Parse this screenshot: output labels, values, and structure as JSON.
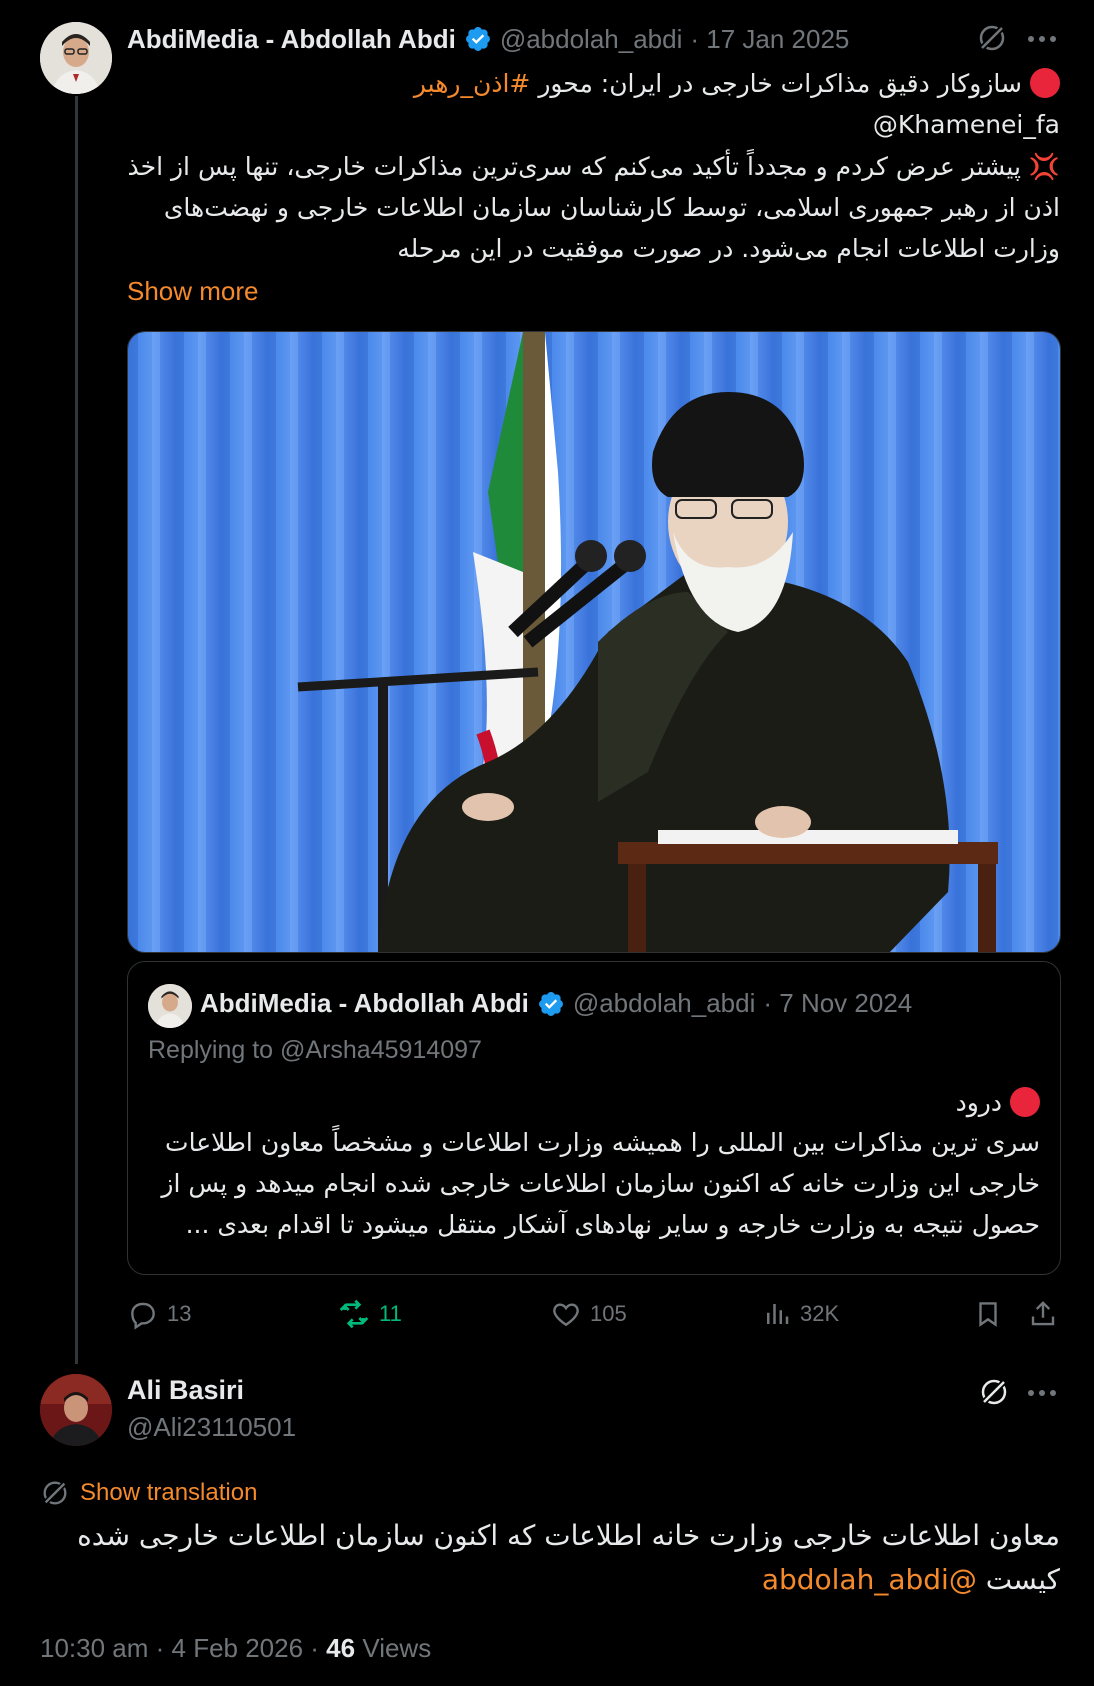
{
  "main_tweet": {
    "display_name": "AbdiMedia - Abdollah Abdi",
    "handle": "@abdolah_abdi",
    "date": "· 17 Jan 2025",
    "line1_text": "سازوکار دقیق مذاکرات خارجی در ایران: محور",
    "line1_hashtag": "#اذن_رهبر",
    "mention": "@Khamenei_fa",
    "body_lines": [
      "💢 پیشتر عرض کردم و مجدداً تأکید می‌کنم که سری‌ترین مذاکرات خارجی، تنها پس از اخذ",
      "اذن از رهبر جمهوری اسلامی، توسط کارشناسان سازمان اطلاعات خارجی و نهضت‌های",
      "وزارت اطلاعات انجام می‌شود. در صورت موفقیت در این مرحله"
    ],
    "show_more": "Show more",
    "stats": {
      "replies": "13",
      "retweets": "11",
      "likes": "105",
      "views": "32K"
    }
  },
  "quoted_tweet": {
    "display_name": "AbdiMedia - Abdollah Abdi",
    "handle": "@abdolah_abdi",
    "date": "· 7 Nov 2024",
    "replying_to": "Replying to @Arsha45914097",
    "greeting": "درود",
    "body_lines": [
      "سری ترین مذاکرات بین المللی را همیشه وزارت اطلاعات و مشخصاً معاون اطلاعات",
      "خارجی این وزارت خانه که اکنون سازمان اطلاعات خارجی شده انجام میدهد و پس از",
      "حصول نتیجه به وزارت خارجه و سایر نهادهای آشکار منتقل میشود تا اقدام بعدی ..."
    ]
  },
  "reply_tweet": {
    "display_name": "Ali Basiri",
    "handle": "@Ali23110501",
    "show_translation": "Show translation",
    "line1": "معاون اطلاعات خارجی وزارت خانه اطلاعات  که اکنون سازمان اطلاعات خارجی شده",
    "line2_word": "کیست",
    "line2_mention": "@abdolah_abdi",
    "meta_time": "10:30 am · 4 Feb 2026 · ",
    "meta_views_count": "46",
    "meta_views_label": " Views"
  },
  "colors": {
    "accent": "#f48a2c",
    "verified": "#1d9bf0",
    "retweet_active": "#00ba7c",
    "muted": "#71767b"
  }
}
